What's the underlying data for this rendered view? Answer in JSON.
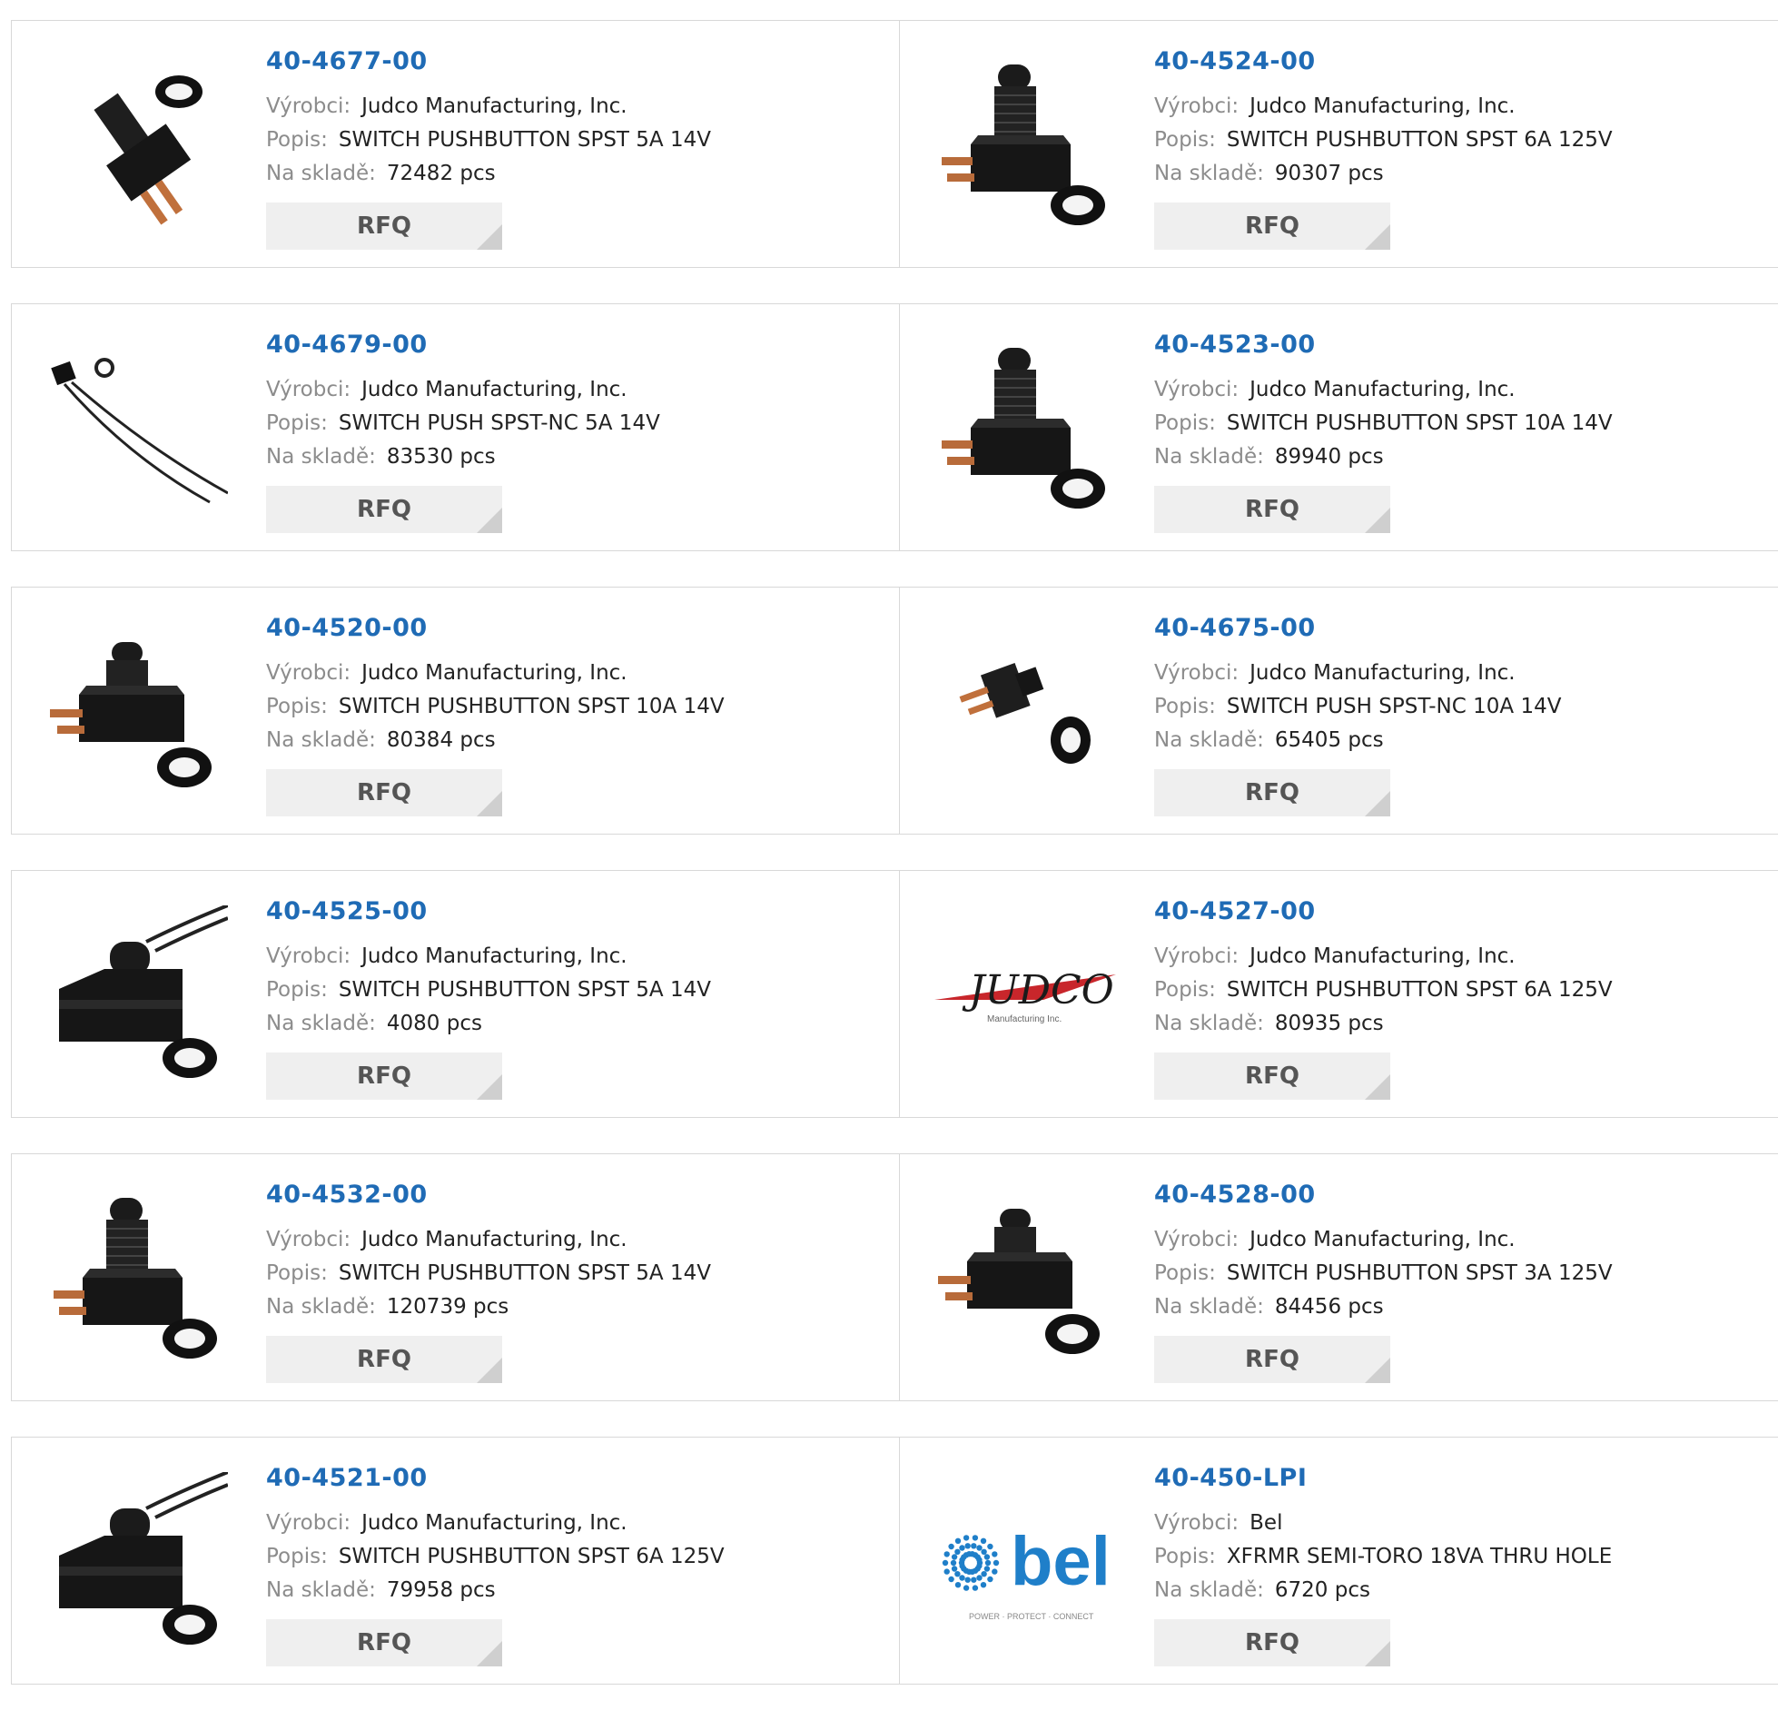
{
  "labels": {
    "manufacturer": "Výrobci:",
    "description": "Popis:",
    "stock": "Na skladě:",
    "rfq": "RFQ"
  },
  "products": [
    {
      "part": "40-4677-00",
      "manufacturer": "Judco Manufacturing, Inc.",
      "description": "SWITCH PUSHBUTTON SPST 5A 14V",
      "stock": "72482 pcs",
      "image": "switch-angled"
    },
    {
      "part": "40-4524-00",
      "manufacturer": "Judco Manufacturing, Inc.",
      "description": "SWITCH PUSHBUTTON SPST 6A 125V",
      "stock": "90307 pcs",
      "image": "switch-tall"
    },
    {
      "part": "40-4679-00",
      "manufacturer": "Judco Manufacturing, Inc.",
      "description": "SWITCH PUSH SPST-NC 5A 14V",
      "stock": "83530 pcs",
      "image": "switch-wired-small"
    },
    {
      "part": "40-4523-00",
      "manufacturer": "Judco Manufacturing, Inc.",
      "description": "SWITCH PUSHBUTTON SPST 10A 14V",
      "stock": "89940 pcs",
      "image": "switch-tall"
    },
    {
      "part": "40-4520-00",
      "manufacturer": "Judco Manufacturing, Inc.",
      "description": "SWITCH PUSHBUTTON SPST 10A 14V",
      "stock": "80384 pcs",
      "image": "switch-short"
    },
    {
      "part": "40-4675-00",
      "manufacturer": "Judco Manufacturing, Inc.",
      "description": "SWITCH PUSH SPST-NC 10A 14V",
      "stock": "65405 pcs",
      "image": "switch-mini"
    },
    {
      "part": "40-4525-00",
      "manufacturer": "Judco Manufacturing, Inc.",
      "description": "SWITCH PUSHBUTTON SPST 5A 14V",
      "stock": "4080 pcs",
      "image": "switch-wired-block"
    },
    {
      "part": "40-4527-00",
      "manufacturer": "Judco Manufacturing, Inc.",
      "description": "SWITCH PUSHBUTTON SPST 6A 125V",
      "stock": "80935 pcs",
      "image": "judco-logo",
      "logo_text": "JUDCO",
      "logo_subtext": "Manufacturing Inc."
    },
    {
      "part": "40-4532-00",
      "manufacturer": "Judco Manufacturing, Inc.",
      "description": "SWITCH PUSHBUTTON SPST 5A 14V",
      "stock": "120739 pcs",
      "image": "switch-tall"
    },
    {
      "part": "40-4528-00",
      "manufacturer": "Judco Manufacturing, Inc.",
      "description": "SWITCH PUSHBUTTON SPST 3A 125V",
      "stock": "84456 pcs",
      "image": "switch-short"
    },
    {
      "part": "40-4521-00",
      "manufacturer": "Judco Manufacturing, Inc.",
      "description": "SWITCH PUSHBUTTON SPST 6A 125V",
      "stock": "79958 pcs",
      "image": "switch-wired-block"
    },
    {
      "part": "40-450-LPI",
      "manufacturer": "Bel",
      "description": "XFRMR SEMI-TORO 18VA THRU HOLE",
      "stock": "6720 pcs",
      "image": "bel-logo",
      "logo_text": "bel",
      "logo_subtext": "POWER · PROTECT · CONNECT"
    }
  ],
  "colors": {
    "part_link": "#1f6bb5",
    "label_gray": "#8c8c8c",
    "rfq_bg": "#efefef",
    "border": "#d8d8d8",
    "bel_blue": "#1f7fc9",
    "judco_red": "#c8262b"
  }
}
